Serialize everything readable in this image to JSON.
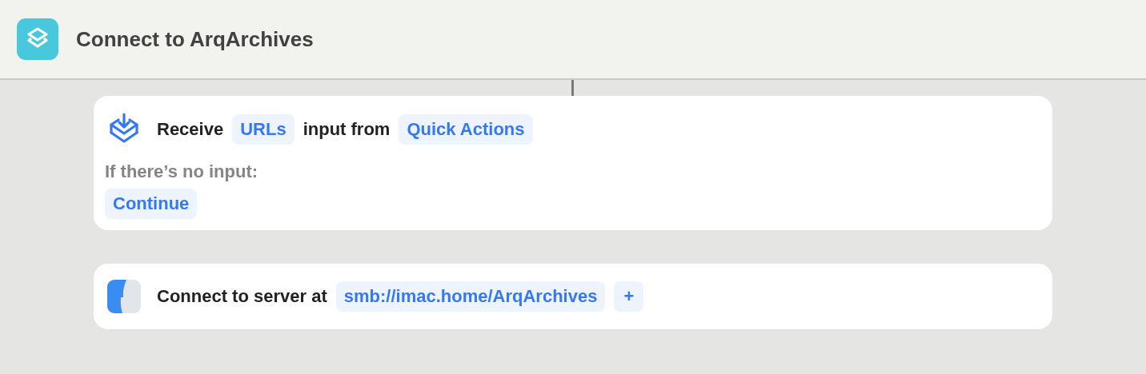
{
  "window": {
    "title": "Connect to ArqArchives"
  },
  "actions": [
    {
      "kind": "receive",
      "parts": [
        {
          "kind": "text",
          "text": "Receive"
        },
        {
          "kind": "token",
          "text": "URLs"
        },
        {
          "kind": "text",
          "text": "input from"
        },
        {
          "kind": "token",
          "text": "Quick Actions"
        }
      ],
      "fallback_label": "If there’s no input:",
      "fallback": "Continue"
    },
    {
      "kind": "finder",
      "parts": [
        {
          "kind": "text",
          "text": "Connect to server at"
        },
        {
          "kind": "token",
          "text": "smb://imac.home/ArqArchives"
        },
        {
          "kind": "add",
          "text": "+"
        }
      ]
    }
  ]
}
